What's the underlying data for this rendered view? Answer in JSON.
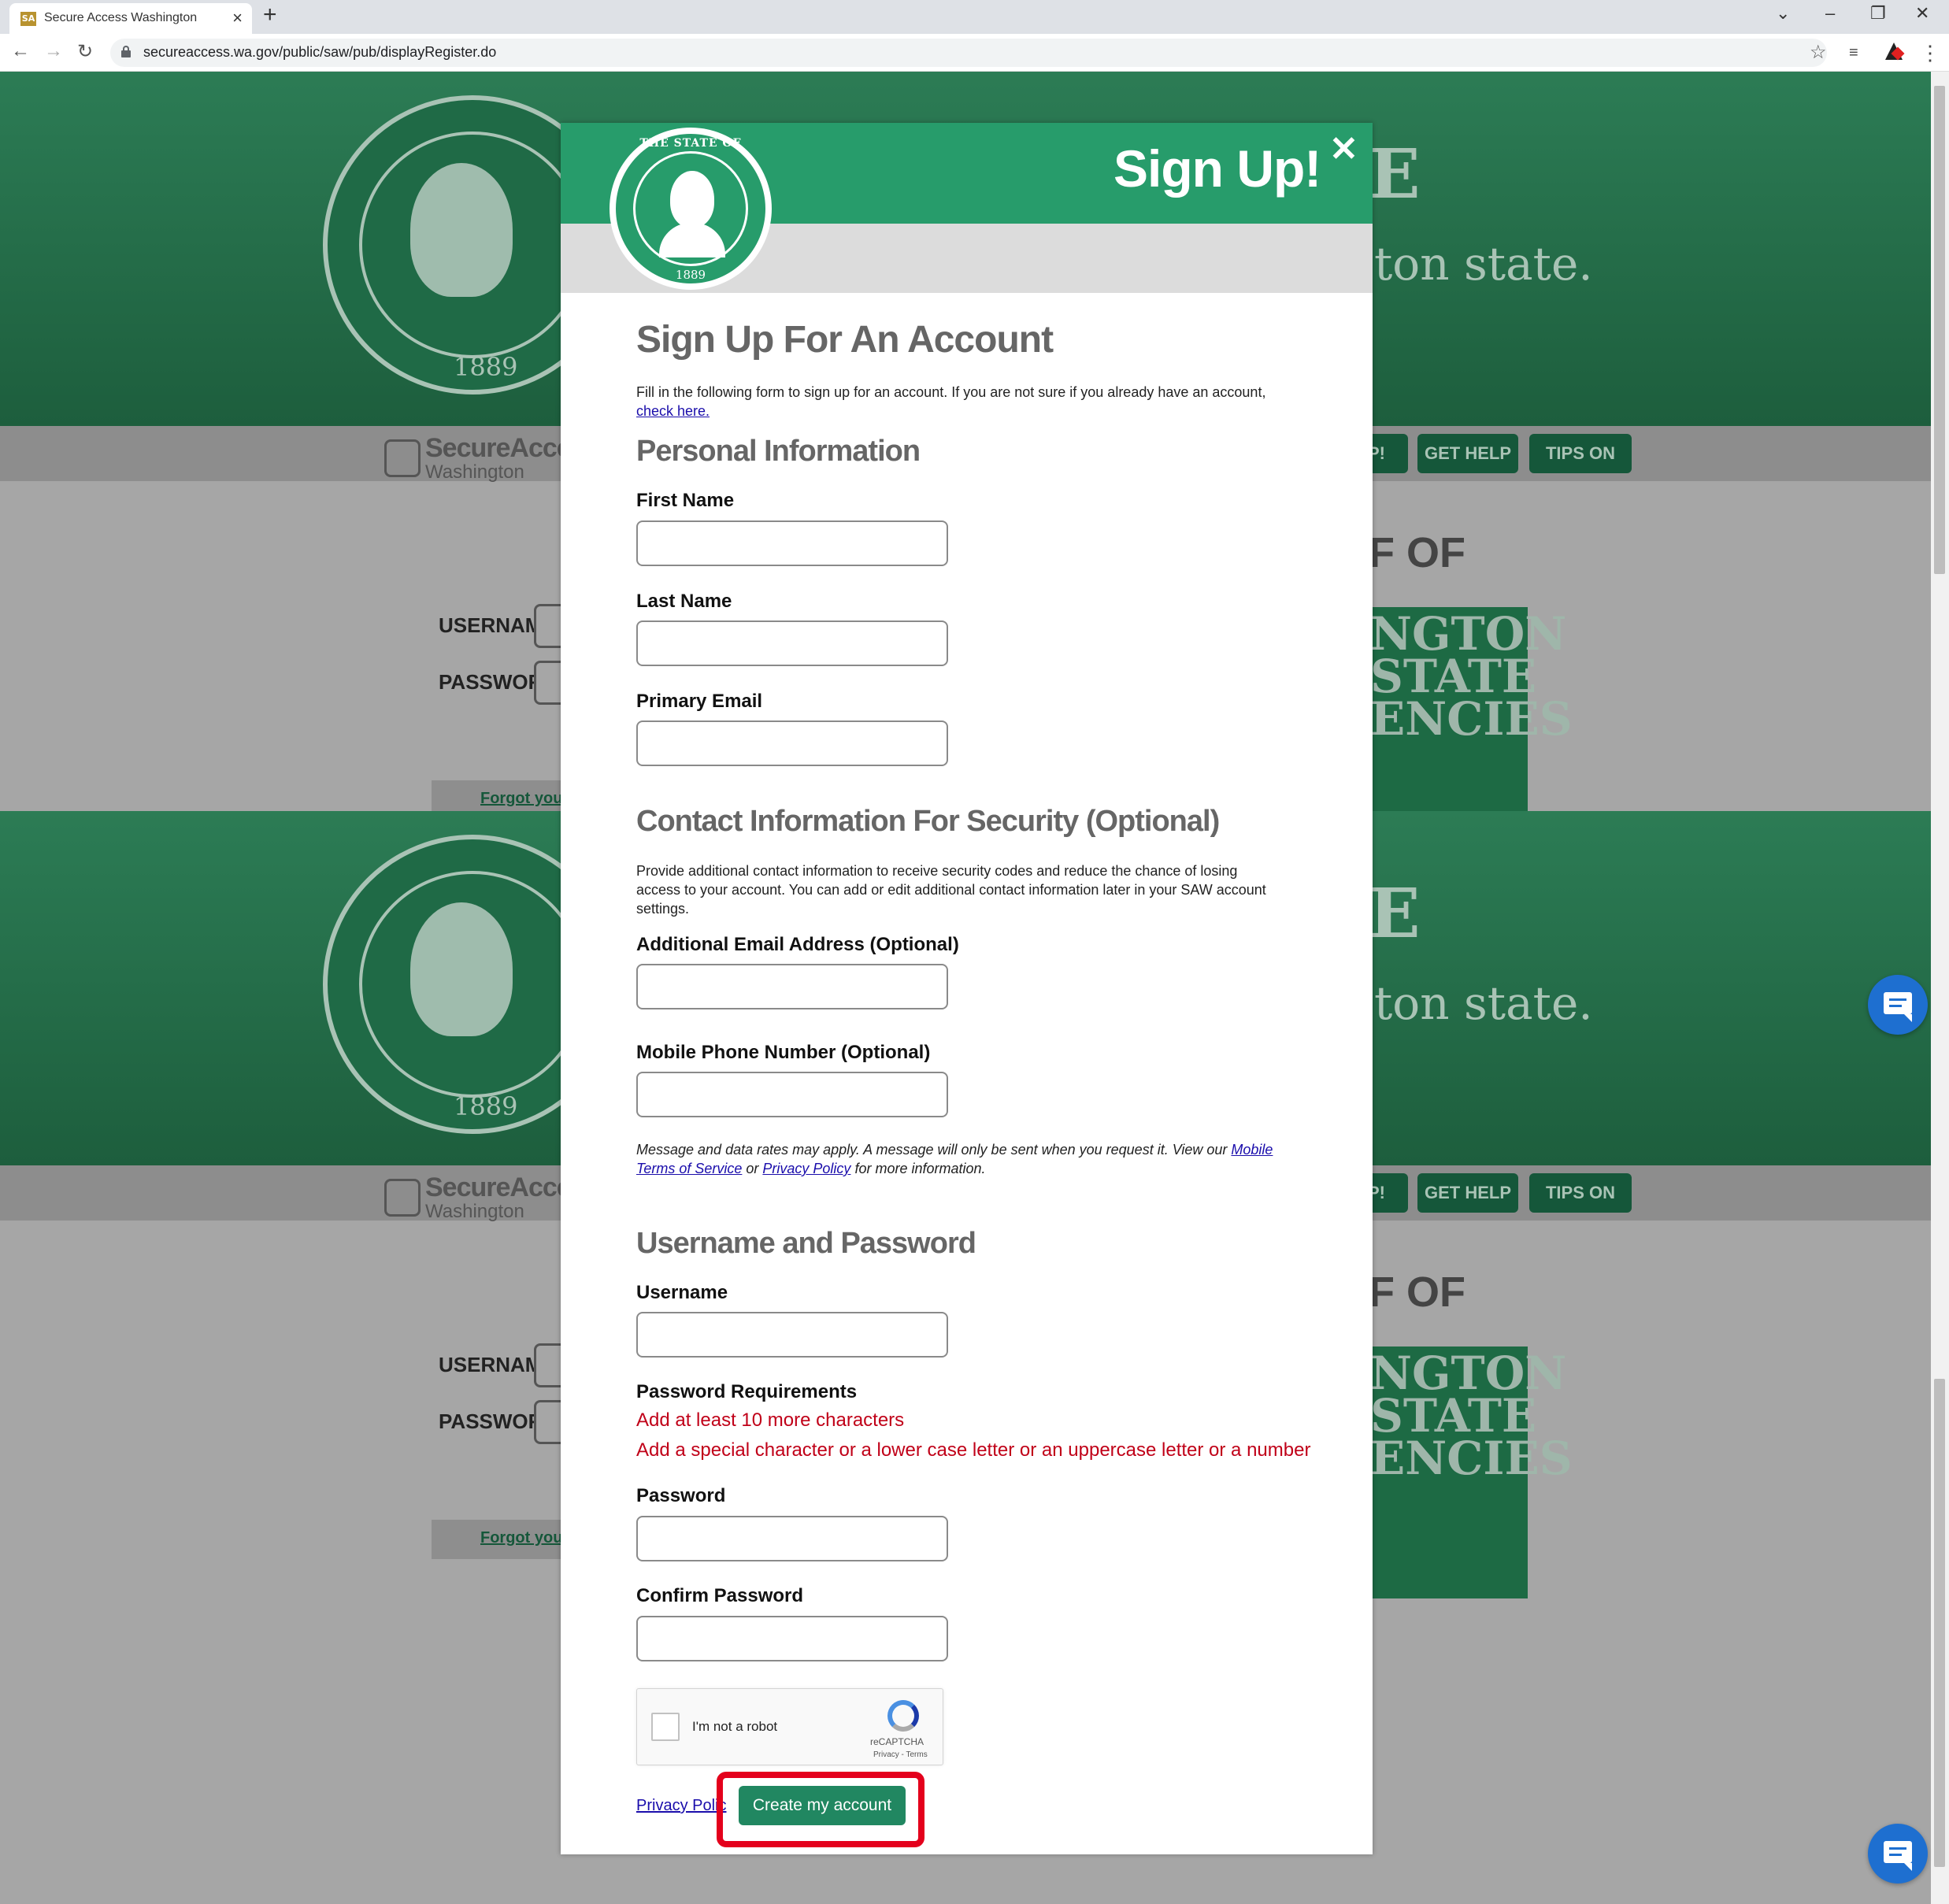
{
  "browser": {
    "tab_title": "Secure Access Washington",
    "favicon_text": "SA",
    "url": "secureaccess.wa.gov/public/saw/pub/displayRegister.do"
  },
  "background": {
    "tagline_fragment": "ton state.",
    "seal_year": "1889",
    "logo_line1": "SecureAccess",
    "logo_line2": "Washington",
    "nav_signup_fragment": "P!",
    "nav_get_help": "GET HELP",
    "nav_tips_on": "TIPS ON",
    "username_label": "USERNAME",
    "password_label": "PASSWORD",
    "forgot_fragment": "Forgot your",
    "heading_fragment": "F OF",
    "agency_lines": [
      "NGTON",
      "STATE",
      "ENCIES"
    ]
  },
  "modal": {
    "title": "Sign Up!",
    "close": "✕",
    "seal_arc": "THE STATE OF",
    "seal_year": "1889",
    "heading": "Sign Up For An Account",
    "intro": "Fill in the following form to sign up for an account. If you are not sure if you already have an account,",
    "intro_link": "check here.",
    "personal_heading": "Personal Information",
    "first_name_label": "First Name",
    "last_name_label": "Last Name",
    "primary_email_label": "Primary Email",
    "contact_heading": "Contact Information For Security (Optional)",
    "contact_desc": "Provide additional contact information to receive security codes and reduce the chance of losing access to your account. You can add or edit additional contact information later in your SAW account settings.",
    "additional_email_label": "Additional Email Address (Optional)",
    "mobile_label": "Mobile Phone Number (Optional)",
    "sms_note_1": "Message and data rates may apply. A message will only be sent when you request it. View our ",
    "sms_link_terms": "Mobile Terms of Service",
    "sms_note_2": " or ",
    "sms_link_privacy": "Privacy Policy",
    "sms_note_3": " for more information.",
    "credentials_heading": "Username and Password",
    "username_label": "Username",
    "password_requirements_label": "Password Requirements",
    "requirement_1": "Add at least 10 more characters",
    "requirement_2": "Add a special character or a lower case letter or an uppercase letter or a number",
    "password_label": "Password",
    "confirm_password_label": "Confirm Password",
    "captcha_text": "I'm not a robot",
    "captcha_brand": "reCAPTCHA",
    "captcha_links": "Privacy - Terms",
    "privacy_link": "Privacy Polic",
    "create_button": "Create my account"
  },
  "colors": {
    "header_green": "#279c6b",
    "button_green": "#218761",
    "requirement_red": "#c00018",
    "highlight_red": "#e4001c",
    "chat_blue": "#1e6fd0"
  }
}
